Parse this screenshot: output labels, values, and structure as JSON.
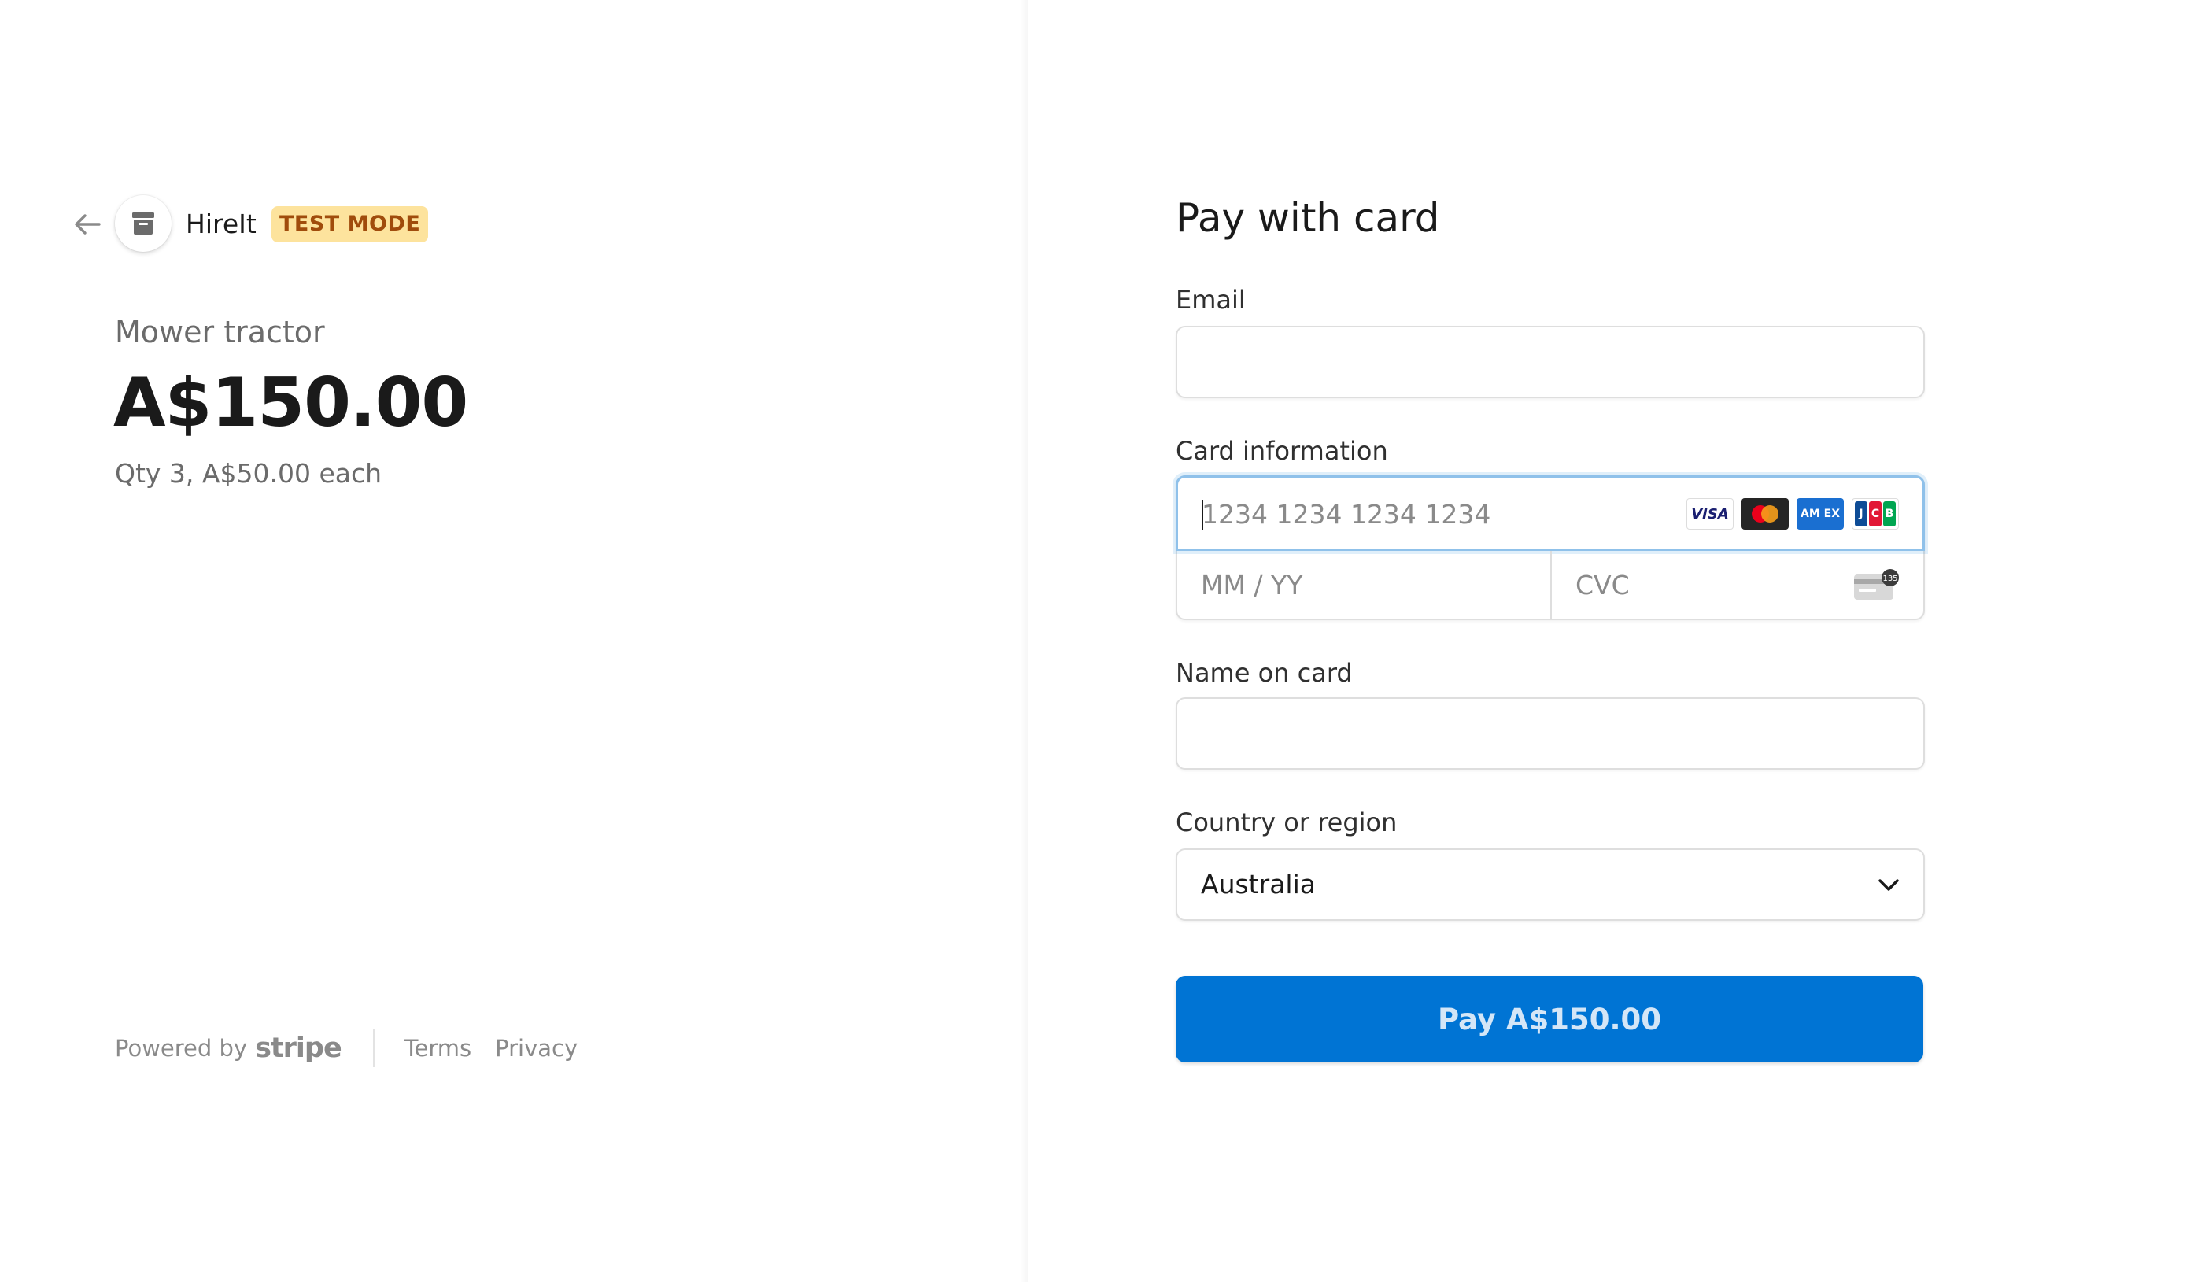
{
  "merchant": {
    "name": "HireIt",
    "badge": "TEST MODE"
  },
  "product": {
    "name": "Mower tractor",
    "price": "A$150.00",
    "quantity_text": "Qty 3, A$50.00 each"
  },
  "footer": {
    "powered_by": "Powered by",
    "brand": "stripe",
    "links": [
      "Terms",
      "Privacy"
    ]
  },
  "form": {
    "title": "Pay with card",
    "email": {
      "label": "Email",
      "value": ""
    },
    "card": {
      "label": "Card information",
      "number_placeholder": "1234 1234 1234 1234",
      "expiry_placeholder": "MM / YY",
      "cvc_placeholder": "CVC",
      "brands": [
        "visa",
        "mastercard",
        "amex",
        "jcb"
      ],
      "visa_text": "VISA",
      "amex_text": "AM EX",
      "jcb_letters": [
        "J",
        "C",
        "B"
      ],
      "cvc_badge": "135"
    },
    "name": {
      "label": "Name on card",
      "value": ""
    },
    "country": {
      "label": "Country or region",
      "value": "Australia"
    },
    "pay_button": "Pay A$150.00"
  },
  "colors": {
    "accent": "#0074d4",
    "badge_bg": "#fde39d",
    "badge_text": "#a04c0c",
    "focus_ring": "#8fc1ea"
  }
}
